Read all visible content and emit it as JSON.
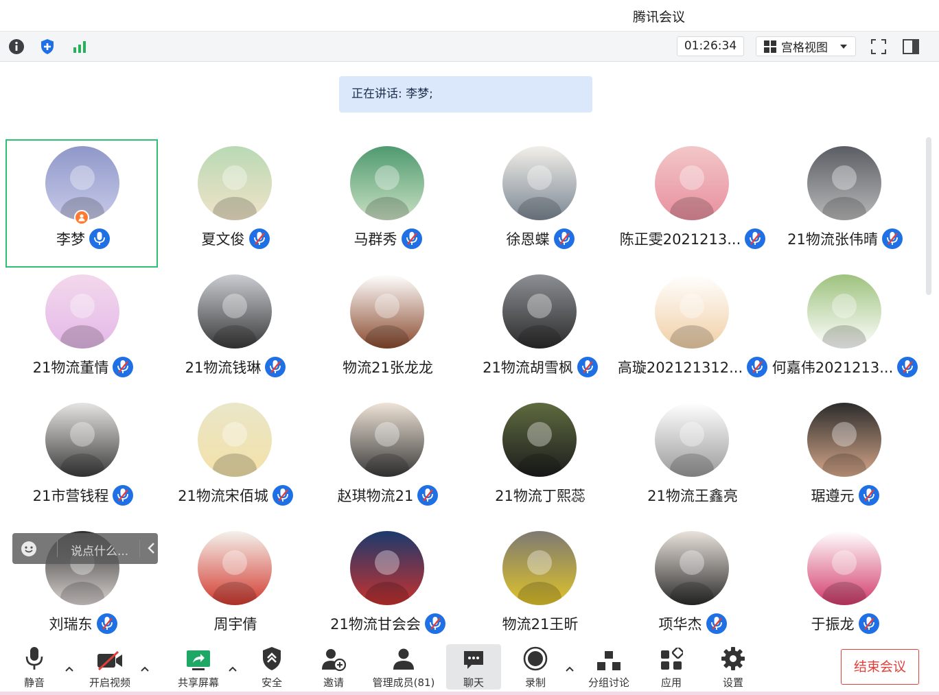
{
  "app": {
    "title": "腾讯会议"
  },
  "toolbar": {
    "timer": "01:26:34",
    "view_mode": "宫格视图"
  },
  "speaking": {
    "text": "正在讲话: 李梦;"
  },
  "participants": [
    {
      "name": "李梦",
      "mic": "on",
      "host": true,
      "active": true,
      "avatar_colors": [
        "#8f98c9",
        "#c7c9e8"
      ]
    },
    {
      "name": "夏文俊",
      "mic": "muted",
      "avatar_colors": [
        "#b9d9b4",
        "#f0e3c8"
      ]
    },
    {
      "name": "马群秀",
      "mic": "muted",
      "avatar_colors": [
        "#4f9a70",
        "#c9e0c2"
      ]
    },
    {
      "name": "徐恩蝶",
      "mic": "muted",
      "avatar_colors": [
        "#f2efe9",
        "#7b8794"
      ]
    },
    {
      "name": "陈正雯2021213...",
      "mic": "muted",
      "avatar_colors": [
        "#f2c7c7",
        "#e88f9f"
      ]
    },
    {
      "name": "21物流张伟晴",
      "mic": "muted",
      "avatar_colors": [
        "#5a5d63",
        "#b9b9b9"
      ]
    },
    {
      "name": "21物流董情",
      "mic": "muted",
      "avatar_colors": [
        "#f3d8ec",
        "#e4b8e8"
      ]
    },
    {
      "name": "21物流钱琳",
      "mic": "muted",
      "avatar_colors": [
        "#c9ccd1",
        "#3a3a3a"
      ]
    },
    {
      "name": "物流21张龙龙",
      "mic": "none",
      "avatar_colors": [
        "#ffffff",
        "#8a4a2e"
      ]
    },
    {
      "name": "21物流胡雪枫",
      "mic": "muted",
      "avatar_colors": [
        "#8c8f94",
        "#2b2b2b"
      ]
    },
    {
      "name": "高璇202121312...",
      "mic": "muted",
      "avatar_colors": [
        "#ffffff",
        "#f0cfa5"
      ]
    },
    {
      "name": "何嘉伟2021213...",
      "mic": "muted",
      "avatar_colors": [
        "#9ec27e",
        "#ffffff"
      ]
    },
    {
      "name": "21市营钱程",
      "mic": "muted",
      "avatar_colors": [
        "#e6e4e2",
        "#3c3c3c"
      ]
    },
    {
      "name": "21物流宋佰城",
      "mic": "muted",
      "avatar_colors": [
        "#eae6c9",
        "#f3e1a8"
      ]
    },
    {
      "name": "赵琪物流21",
      "mic": "muted",
      "avatar_colors": [
        "#eee3d6",
        "#3a3a3a"
      ]
    },
    {
      "name": "21物流丁熙蕊",
      "mic": "none",
      "avatar_colors": [
        "#5e6b3f",
        "#1d1d1d"
      ]
    },
    {
      "name": "21物流王鑫亮",
      "mic": "none",
      "avatar_colors": [
        "#ffffff",
        "#9a9a9a"
      ]
    },
    {
      "name": "琚遵元",
      "mic": "muted",
      "avatar_colors": [
        "#2c2c2c",
        "#d6a78a"
      ]
    },
    {
      "name": "刘瑞东",
      "mic": "muted",
      "avatar_colors": [
        "#2e2e2e",
        "#d9d2cf"
      ]
    },
    {
      "name": "周宇倩",
      "mic": "none",
      "avatar_colors": [
        "#f4f1ec",
        "#d23a2f"
      ]
    },
    {
      "name": "21物流甘会会",
      "mic": "muted",
      "avatar_colors": [
        "#1b3a6d",
        "#c8322f"
      ]
    },
    {
      "name": "物流21王昕",
      "mic": "none",
      "avatar_colors": [
        "#7d7a72",
        "#e0c32a"
      ]
    },
    {
      "name": "项华杰",
      "mic": "muted",
      "avatar_colors": [
        "#e9e2db",
        "#2b2b2b"
      ]
    },
    {
      "name": "于振龙",
      "mic": "muted",
      "avatar_colors": [
        "#ffffff",
        "#d23a6a"
      ]
    }
  ],
  "chat": {
    "placeholder": "说点什么..."
  },
  "bottom_bar": {
    "mute": "静音",
    "video": "开启视频",
    "share": "共享屏幕",
    "security": "安全",
    "invite": "邀请",
    "members": "管理成员(81)",
    "chat": "聊天",
    "record": "录制",
    "breakout": "分组讨论",
    "apps": "应用",
    "settings": "设置",
    "end": "结束会议"
  },
  "colors": {
    "accent": "#1f6fe5",
    "active_border": "#2fbf71",
    "end_button": "#e0403a",
    "speaking_bg": "#dbe8fc"
  }
}
